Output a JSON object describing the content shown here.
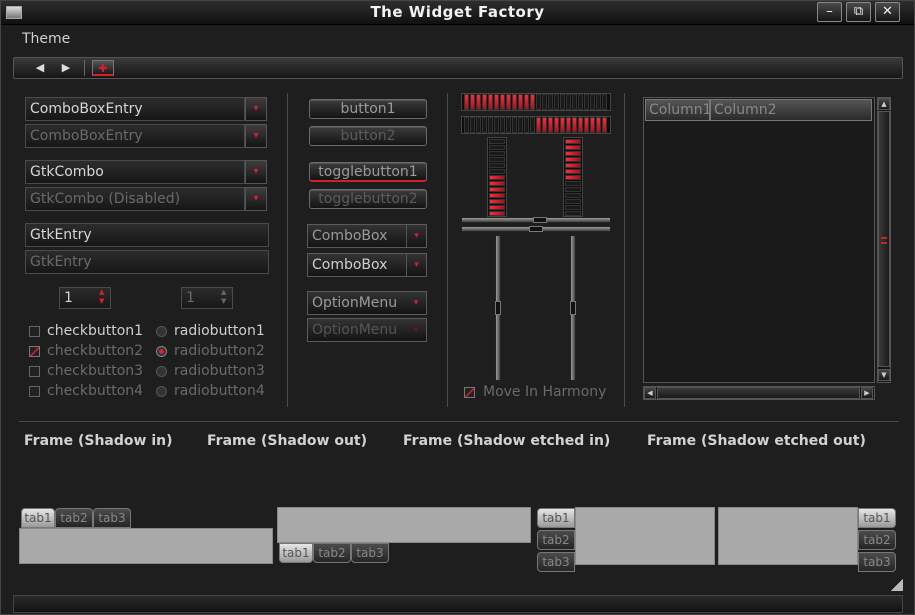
{
  "window": {
    "title": "The Widget Factory",
    "min_label": "–",
    "restore_label": "⧉",
    "close_label": "✕"
  },
  "menu": {
    "theme": "Theme"
  },
  "toolbar": {
    "back": "◀",
    "forward": "▶",
    "tool": "✚"
  },
  "col1": {
    "combo_entry": "ComboBoxEntry",
    "combo_entry_disabled": "ComboBoxEntry",
    "gtk_combo": "GtkCombo",
    "gtk_combo_disabled": "GtkCombo (Disabled)",
    "entry": "GtkEntry",
    "entry_disabled": "GtkEntry",
    "spin1": "1",
    "spin2": "1",
    "checks": [
      "checkbutton1",
      "checkbutton2",
      "checkbutton3",
      "checkbutton4"
    ],
    "radios": [
      "radiobutton1",
      "radiobutton2",
      "radiobutton3",
      "radiobutton4"
    ]
  },
  "col2": {
    "button1": "button1",
    "button2": "button2",
    "toggle1": "togglebutton1",
    "toggle2": "togglebutton2",
    "combobox1": "ComboBox",
    "combobox2": "ComboBox",
    "option1": "OptionMenu",
    "option2": "OptionMenu"
  },
  "col3": {
    "progress_h1": 0.5,
    "progress_h2": 0.5,
    "progress_v1": 0.5,
    "progress_v2": 0.5,
    "harmony": "Move In Harmony"
  },
  "tree": {
    "columns": [
      "Column1",
      "Column2"
    ]
  },
  "frames": [
    "Frame (Shadow in)",
    "Frame (Shadow out)",
    "Frame (Shadow etched in)",
    "Frame (Shadow etched out)"
  ],
  "tabs": {
    "t1": "tab1",
    "t2": "tab2",
    "t3": "tab3"
  },
  "colors": {
    "accent": "#d4202a",
    "background": "#1e1e1e",
    "panel": "#a9a9a9"
  }
}
